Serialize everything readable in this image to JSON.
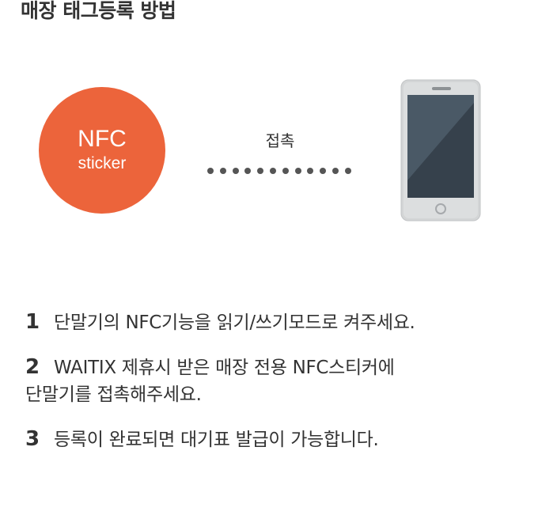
{
  "page": {
    "title": "매장 태그등록 방법"
  },
  "diagram": {
    "sticker_line1": "NFC",
    "sticker_line2": "sticker",
    "contact_label": "접촉",
    "sticker_color": "#ec643b",
    "phone_icon": "smartphone-icon"
  },
  "steps": [
    {
      "num": "1",
      "text": "단말기의 NFC기능을 읽기/쓰기모드로 켜주세요."
    },
    {
      "num": "2",
      "text_line1": "WAITIX 제휴시 받은 매장 전용 NFC스티커에",
      "text_line2": "단말기를 접촉해주세요."
    },
    {
      "num": "3",
      "text": "등록이 완료되면 대기표 발급이 가능합니다."
    }
  ]
}
